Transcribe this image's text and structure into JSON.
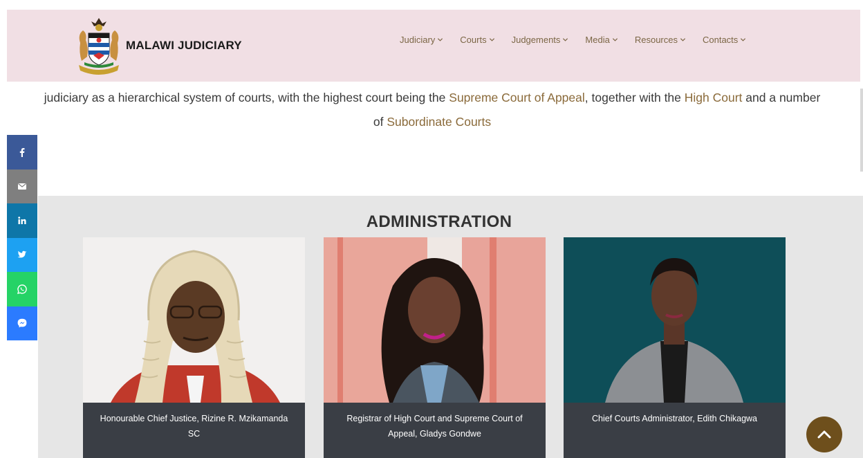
{
  "header": {
    "brand_name": "MALAWI JUDICIARY",
    "nav": [
      {
        "label": "Judiciary"
      },
      {
        "label": "Courts"
      },
      {
        "label": "Judgements"
      },
      {
        "label": "Media"
      },
      {
        "label": "Resources"
      },
      {
        "label": "Contacts"
      }
    ]
  },
  "intro": {
    "part1": "judiciary as a hierarchical system of courts, with the highest court being the ",
    "link1": "Supreme Court of Appeal",
    "part2": ", together with the ",
    "link2": "High Court",
    "part3": " and a number of ",
    "link3": "Subordinate Courts"
  },
  "administration": {
    "title": "ADMINISTRATION",
    "cards": [
      {
        "caption": "Honourable Chief Justice, Rizine R. Mzikamanda SC"
      },
      {
        "caption": "Registrar of High Court and Supreme Court of Appeal, Gladys Gondwe"
      },
      {
        "caption": "Chief Courts Administrator, Edith Chikagwa"
      }
    ]
  },
  "share": [
    {
      "icon": "facebook-icon",
      "color": "#3b5998"
    },
    {
      "icon": "email-icon",
      "color": "#7f7f7f"
    },
    {
      "icon": "linkedin-icon",
      "color": "#0e76a8"
    },
    {
      "icon": "twitter-icon",
      "color": "#1da1f2"
    },
    {
      "icon": "whatsapp-icon",
      "color": "#25d366"
    },
    {
      "icon": "messenger-icon",
      "color": "#2b7bff"
    }
  ],
  "colors": {
    "header_bg": "#f1dfe4",
    "nav_text": "#7b6645",
    "highlight": "#8a6a3a",
    "caption_bg": "#3a3e45",
    "to_top_bg": "#6e4f1c"
  }
}
